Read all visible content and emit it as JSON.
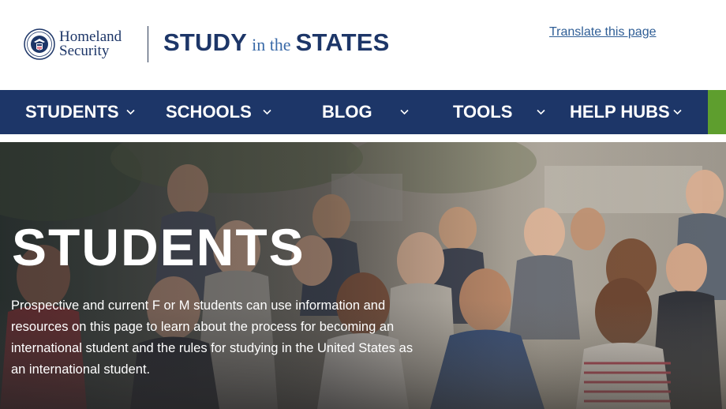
{
  "header": {
    "dhs_logo": {
      "line1": "Homeland",
      "line2": "Security",
      "icon": "dhs-seal-icon"
    },
    "site_logo": {
      "part1": "STUDY",
      "part2": "in the",
      "part3": "STATES"
    },
    "translate_link": "Translate this page"
  },
  "nav": {
    "items": [
      {
        "label": "STUDENTS",
        "icon": "chevron-down-icon"
      },
      {
        "label": "SCHOOLS",
        "icon": "chevron-down-icon"
      },
      {
        "label": "BLOG",
        "icon": "chevron-down-icon"
      },
      {
        "label": "TOOLS",
        "icon": "chevron-down-icon"
      },
      {
        "label": "HELP HUBS",
        "icon": "chevron-down-icon"
      }
    ]
  },
  "hero": {
    "title": "STUDENTS",
    "description": "Prospective and current F or M students can use information and resources on this page to learn about the process for becoming an international student and the rules for studying in the United States as an international student."
  },
  "colors": {
    "navy": "#1d3668",
    "accent_green": "#5e9e2e",
    "link_blue": "#2f5e96"
  }
}
